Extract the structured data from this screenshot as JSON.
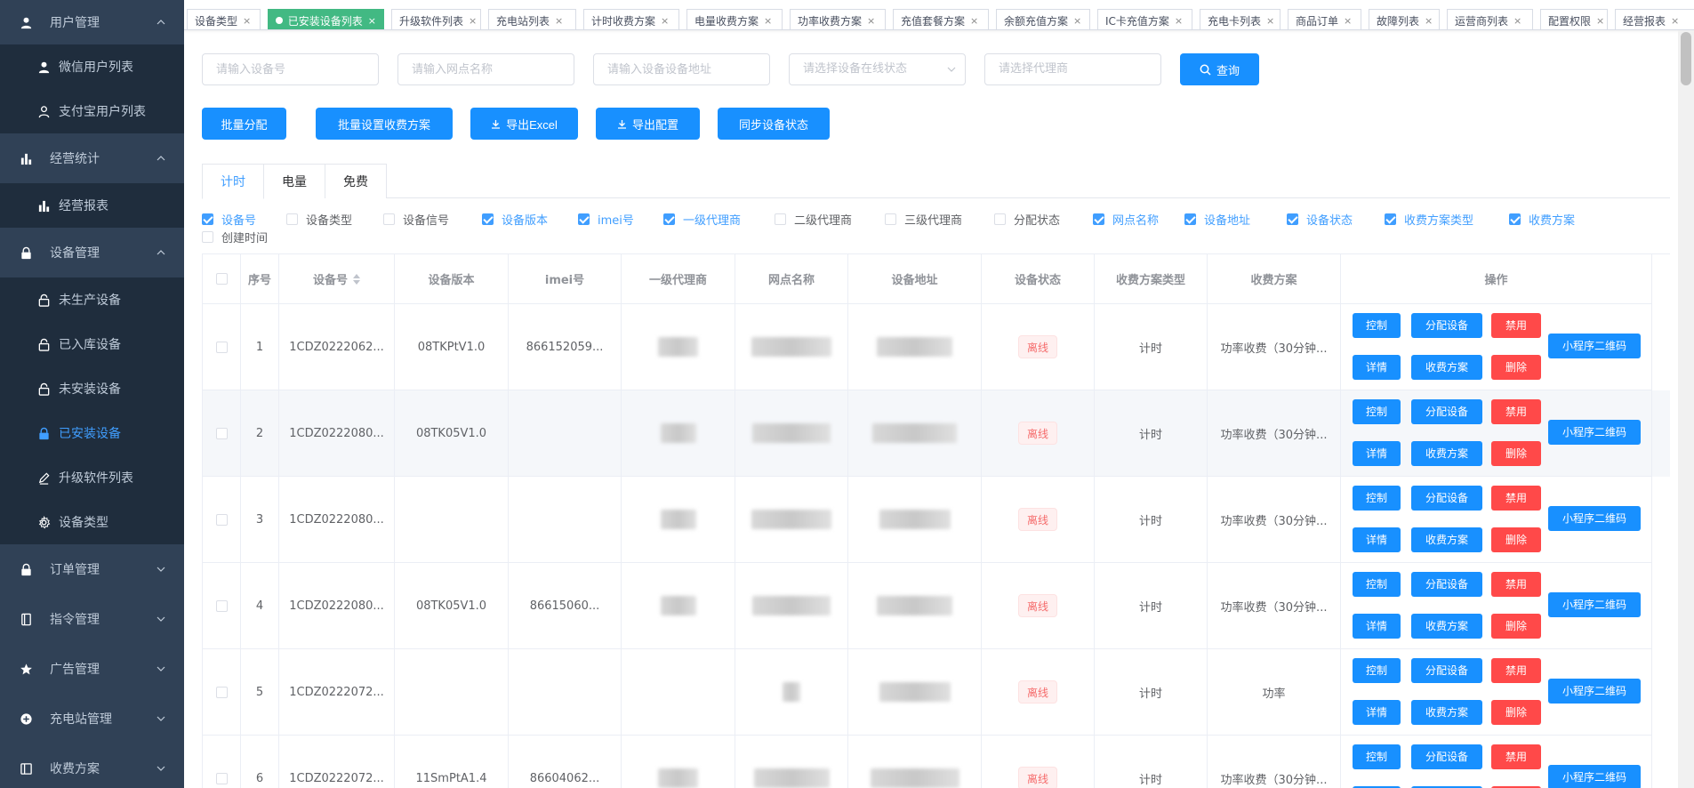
{
  "sidebar": {
    "items": [
      {
        "label": "用户管理",
        "icon": "user-icon",
        "level": "top",
        "arrow": "up"
      },
      {
        "label": "微信用户列表",
        "icon": "user-icon",
        "level": "sub"
      },
      {
        "label": "支付宝用户列表",
        "icon": "user-outline-icon",
        "level": "sub"
      },
      {
        "label": "经营统计",
        "icon": "bar-chart-icon",
        "level": "top",
        "arrow": "up"
      },
      {
        "label": "经营报表",
        "icon": "bar-chart-icon",
        "level": "sub"
      },
      {
        "label": "设备管理",
        "icon": "lock-icon",
        "level": "top",
        "arrow": "up"
      },
      {
        "label": "未生产设备",
        "icon": "lock-open-icon",
        "level": "sub"
      },
      {
        "label": "已入库设备",
        "icon": "lock-open-icon",
        "level": "sub"
      },
      {
        "label": "未安装设备",
        "icon": "lock-open-icon",
        "level": "sub"
      },
      {
        "label": "已安装设备",
        "icon": "lock-icon",
        "level": "sub",
        "active": true
      },
      {
        "label": "升级软件列表",
        "icon": "edit-icon",
        "level": "sub"
      },
      {
        "label": "设备类型",
        "icon": "gear-icon",
        "level": "sub"
      },
      {
        "label": "订单管理",
        "icon": "lock-icon",
        "level": "top",
        "arrow": "down"
      },
      {
        "label": "指令管理",
        "icon": "book-icon",
        "level": "top",
        "arrow": "down"
      },
      {
        "label": "广告管理",
        "icon": "star-icon",
        "level": "top",
        "arrow": "down"
      },
      {
        "label": "充电站管理",
        "icon": "plus-circle-icon",
        "level": "top",
        "arrow": "down"
      },
      {
        "label": "收费方案",
        "icon": "document-icon",
        "level": "top",
        "arrow": "down"
      }
    ]
  },
  "tags": [
    {
      "label": "设备类型"
    },
    {
      "label": "已安装设备列表",
      "active": true
    },
    {
      "label": "升级软件列表"
    },
    {
      "label": "充电站列表"
    },
    {
      "label": "计时收费方案"
    },
    {
      "label": "电量收费方案"
    },
    {
      "label": "功率收费方案"
    },
    {
      "label": "充值套餐方案"
    },
    {
      "label": "余额充值方案"
    },
    {
      "label": "IC卡充值方案"
    },
    {
      "label": "充电卡列表"
    },
    {
      "label": "商品订单"
    },
    {
      "label": "故障列表"
    },
    {
      "label": "运营商列表"
    },
    {
      "label": "配置权限"
    },
    {
      "label": "经营报表"
    }
  ],
  "filters": {
    "device_no_placeholder": "请输入设备号",
    "site_name_placeholder": "请输入网点名称",
    "address_placeholder": "请输入设备设备地址",
    "status_placeholder": "请选择设备在线状态",
    "agent_placeholder": "请选择代理商",
    "query_label": "查询"
  },
  "actions": {
    "batch_assign": "批量分配",
    "batch_fee": "批量设置收费方案",
    "export_excel": "导出Excel",
    "export_config": "导出配置",
    "sync_status": "同步设备状态"
  },
  "tabs": [
    {
      "label": "计时",
      "active": true
    },
    {
      "label": "电量"
    },
    {
      "label": "免费"
    }
  ],
  "columns_toggle": [
    {
      "label": "设备号",
      "on": true
    },
    {
      "label": "设备类型",
      "on": false
    },
    {
      "label": "设备信号",
      "on": false
    },
    {
      "label": "设备版本",
      "on": true
    },
    {
      "label": "imei号",
      "on": true
    },
    {
      "label": "一级代理商",
      "on": true
    },
    {
      "label": "二级代理商",
      "on": false
    },
    {
      "label": "三级代理商",
      "on": false
    },
    {
      "label": "分配状态",
      "on": false
    },
    {
      "label": "网点名称",
      "on": true
    },
    {
      "label": "设备地址",
      "on": true
    },
    {
      "label": "设备状态",
      "on": true
    },
    {
      "label": "收费方案类型",
      "on": true
    },
    {
      "label": "收费方案",
      "on": true
    },
    {
      "label": "创建时间",
      "on": false
    }
  ],
  "table": {
    "headers": [
      "序号",
      "设备号",
      "设备版本",
      "imei号",
      "一级代理商",
      "网点名称",
      "设备地址",
      "设备状态",
      "收费方案类型",
      "收费方案",
      "操作"
    ],
    "rows": [
      {
        "index": "1",
        "device_no": "1CDZ0222062...",
        "version": "08TKPtV1.0",
        "imei": "866152059...",
        "status": "离线",
        "fee_type": "计时",
        "fee_plan": "功率收费（30分钟..."
      },
      {
        "index": "2",
        "device_no": "1CDZ0222080...",
        "version": "08TK05V1.0",
        "imei": "",
        "status": "离线",
        "fee_type": "计时",
        "fee_plan": "功率收费（30分钟..."
      },
      {
        "index": "3",
        "device_no": "1CDZ0222080...",
        "version": "",
        "imei": "",
        "status": "离线",
        "fee_type": "计时",
        "fee_plan": "功率收费（30分钟..."
      },
      {
        "index": "4",
        "device_no": "1CDZ0222080...",
        "version": "08TK05V1.0",
        "imei": "86615060...",
        "status": "离线",
        "fee_type": "计时",
        "fee_plan": "功率收费（30分钟..."
      },
      {
        "index": "5",
        "device_no": "1CDZ0222072...",
        "version": "",
        "imei": "",
        "status": "离线",
        "fee_type": "计时",
        "fee_plan": "功率"
      },
      {
        "index": "6",
        "device_no": "1CDZ0222072...",
        "version": "11SmPtA1.4",
        "imei": "86604062...",
        "status": "离线",
        "fee_type": "计时",
        "fee_plan": "功率收费（30分钟..."
      }
    ],
    "row_buttons": {
      "control": "控制",
      "assign": "分配设备",
      "disable": "禁用",
      "detail": "详情",
      "fee": "收费方案",
      "delete": "删除",
      "qrcode": "小程序二维码"
    }
  },
  "colors": {
    "sidebar_bg": "#304156",
    "sidebar_sub_bg": "#1f2d3d",
    "primary": "#1890ff",
    "danger": "#ff4949",
    "tag_active": "#42b983"
  }
}
